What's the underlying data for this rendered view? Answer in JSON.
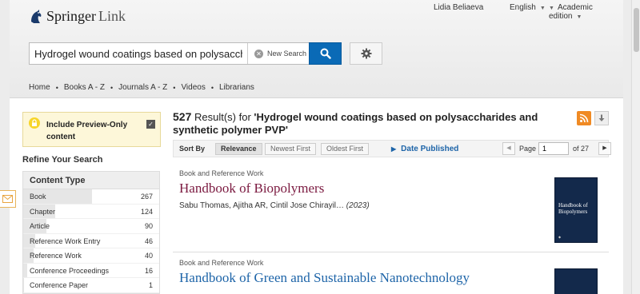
{
  "brand": {
    "name": "Springer",
    "suffix": "Link"
  },
  "account": {
    "user": "Lidia Beliaeva",
    "language": "English",
    "edition": "Academic edition"
  },
  "search": {
    "query": "Hydrogel wound coatings based on polysaccharides and synthetic polymer PVP",
    "new_search_label": "New Search"
  },
  "nav": {
    "items": [
      "Home",
      "Books A - Z",
      "Journals A - Z",
      "Videos",
      "Librarians"
    ]
  },
  "preview": {
    "label": "Include Preview-Only content",
    "checked": true
  },
  "refine": {
    "title": "Refine Your Search",
    "content_type": {
      "heading": "Content Type",
      "items": [
        {
          "label": "Book",
          "count": "267"
        },
        {
          "label": "Chapter",
          "count": "124"
        },
        {
          "label": "Article",
          "count": "90"
        },
        {
          "label": "Reference Work Entry",
          "count": "46"
        },
        {
          "label": "Reference Work",
          "count": "40"
        },
        {
          "label": "Conference Proceedings",
          "count": "16"
        },
        {
          "label": "Conference Paper",
          "count": "1"
        }
      ]
    }
  },
  "results": {
    "count": "527",
    "label": "Result(s) for",
    "query_quoted": "'Hydrogel wound coatings based on polysaccharides and synthetic polymer PVP'"
  },
  "sort": {
    "label": "Sort By",
    "options": [
      "Relevance",
      "Newest First",
      "Oldest First"
    ],
    "active": "Relevance",
    "date_published_label": "Date Published"
  },
  "pagination": {
    "page_label": "Page",
    "current": "1",
    "of_label": "of 27"
  },
  "items": [
    {
      "type": "Book and Reference Work",
      "title": "Handbook of Biopolymers",
      "authors": "Sabu Thomas, Ajitha AR, Cintil Jose Chirayil…",
      "year": "(2023)",
      "cover_title": "Handbook of Biopolymers"
    },
    {
      "type": "Book and Reference Work",
      "title": "Handbook of Green and Sustainable Nanotechnology"
    }
  ],
  "colors": {
    "accent_blue": "#0a6ab6",
    "title_maroon": "#7b1a40",
    "rss_orange": "#f08a24",
    "preview_bg": "#fdf7d9"
  }
}
